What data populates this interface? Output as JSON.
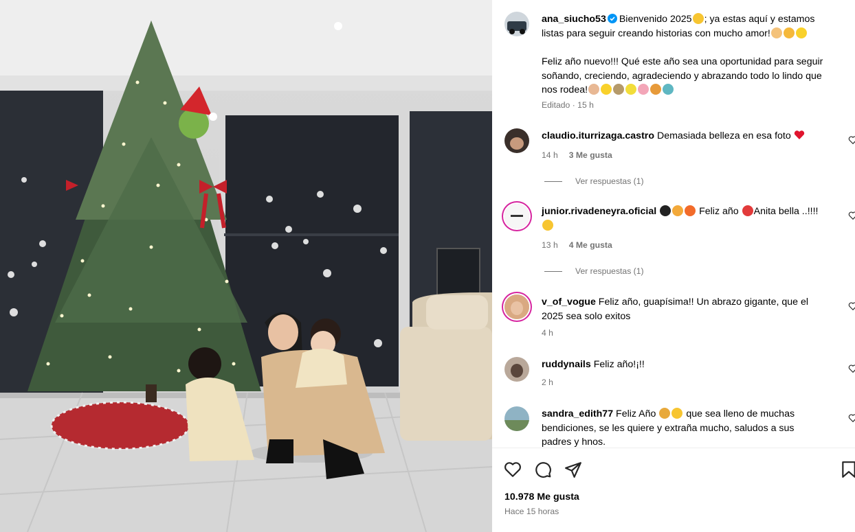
{
  "post": {
    "author": "ana_siucho53",
    "caption_line1": "Bienvenido 2025",
    "caption_line1b": "; ya estas aquí y estamos",
    "caption_line2": "listas para seguir creando historias con mucho amor!",
    "caption_p2_line1": "Feliz año nuevo!!! Qué este año sea una oportunidad para seguir",
    "caption_p2_line2": "soñando, creciendo, agradeciendo y abrazando todo lo lindo que",
    "caption_p2_line3": "nos rodea!",
    "edited": "Editado · 15 h"
  },
  "comments": [
    {
      "user": "claudio.iturrizaga.castro",
      "text": "Demasiada belleza en esa foto",
      "time": "14 h",
      "likes": "3 Me gusta",
      "replies": "Ver respuestas (1)"
    },
    {
      "user": "junior.rivadeneyra.oficial",
      "text_a": "Feliz año",
      "text_b": "Anita bella ..!!!!",
      "time": "13 h",
      "likes": "4 Me gusta",
      "replies": "Ver respuestas (1)"
    },
    {
      "user": "v_of_vogue",
      "text_line1": "Feliz año, guapísima!! Un abrazo gigante, que el",
      "text_line2": "2025 sea solo exitos",
      "time": "4 h"
    },
    {
      "user": "ruddynails",
      "text": "Feliz año!¡!!",
      "time": "2 h"
    },
    {
      "user": "sandra_edith77",
      "text_line1a": "Feliz Año",
      "text_line1b": "que sea lleno de muchas",
      "text_line2": "bendiciones, se les quiere y extraña mucho, saludos a sus",
      "text_line3": "padres y hnos."
    }
  ],
  "footer": {
    "likes": "10.978 Me gusta",
    "posted": "Hace 15 horas"
  },
  "icons": {
    "like": "heart-icon",
    "comment": "comment-icon",
    "share": "share-icon",
    "save": "bookmark-icon",
    "verified": "verified-badge-icon"
  },
  "colors": {
    "verified": "#0095f6",
    "meta_gray": "#737373",
    "heart_red": "#e0142e"
  }
}
